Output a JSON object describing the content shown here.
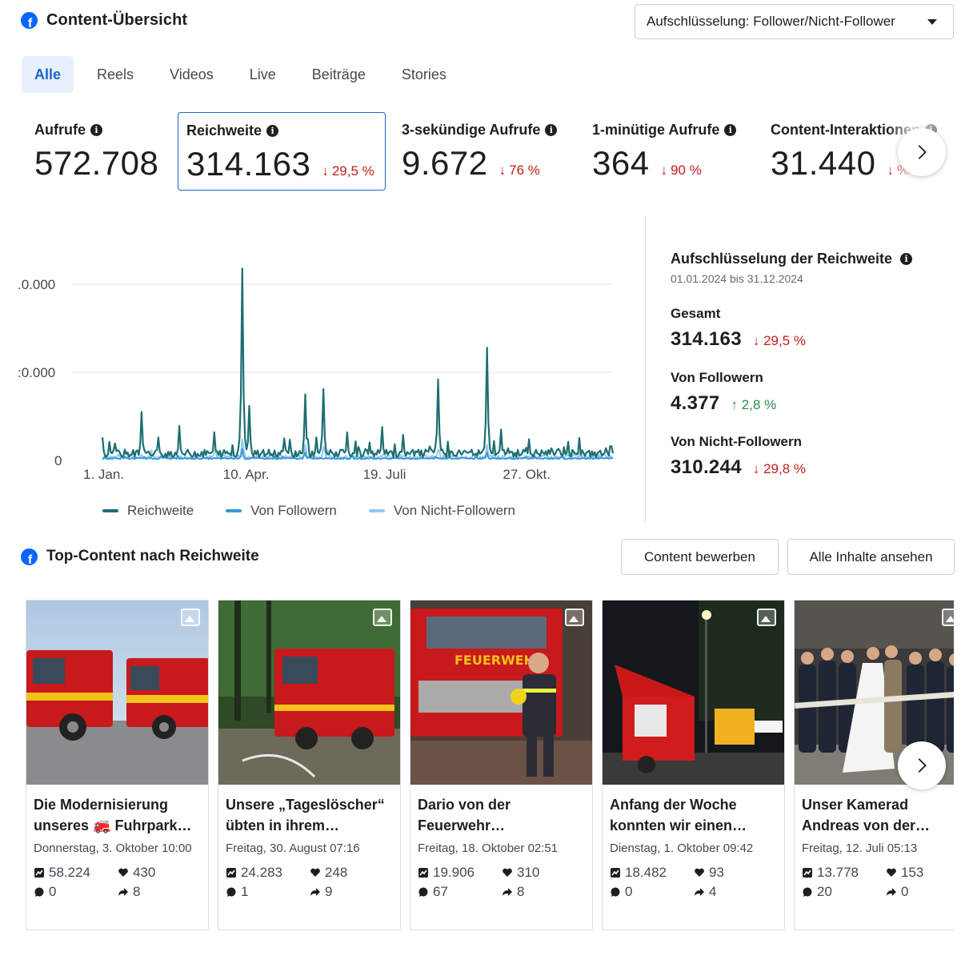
{
  "header": {
    "title": "Content-Übersicht",
    "breakdown_label": "Aufschlüsselung: Follower/Nicht-Follower"
  },
  "tabs": [
    {
      "label": "Alle",
      "active": true
    },
    {
      "label": "Reels"
    },
    {
      "label": "Videos"
    },
    {
      "label": "Live"
    },
    {
      "label": "Beiträge"
    },
    {
      "label": "Stories"
    }
  ],
  "metrics": [
    {
      "label": "Aufrufe",
      "value": "572.708",
      "delta": ""
    },
    {
      "label": "Reichweite",
      "value": "314.163",
      "delta": "29,5 %"
    },
    {
      "label": "3-sekündige Aufrufe",
      "value": "9.672",
      "delta": "76 %"
    },
    {
      "label": "1-minütige Aufrufe",
      "value": "364",
      "delta": "90 %"
    },
    {
      "label": "Content-Interaktionen",
      "value": "31.440",
      "delta": "%"
    }
  ],
  "chart_data": {
    "type": "line",
    "title": "",
    "xlabel": "",
    "ylabel": "",
    "x_ticks": [
      "1. Jan.",
      "10. Apr.",
      "19. Juli",
      "27. Okt."
    ],
    "y_ticks": [
      ".0.000",
      ":0.000",
      "0"
    ],
    "y_tick_values": [
      20000,
      10000,
      0
    ],
    "ylim": [
      0,
      20000
    ],
    "x_domain_days": [
      0,
      365
    ],
    "x_tick_days": [
      0,
      100,
      200,
      300
    ],
    "grid": true,
    "legend_position": "bottom",
    "series": [
      {
        "name": "Reichweite",
        "color": "#1d6f72",
        "peaks": [
          [
            5,
            2100
          ],
          [
            28,
            5500
          ],
          [
            55,
            3900
          ],
          [
            80,
            3200
          ],
          [
            100,
            21800
          ],
          [
            105,
            6200
          ],
          [
            130,
            2500
          ],
          [
            145,
            7500
          ],
          [
            158,
            8100
          ],
          [
            175,
            3200
          ],
          [
            200,
            3800
          ],
          [
            215,
            2900
          ],
          [
            240,
            9200
          ],
          [
            275,
            12800
          ],
          [
            285,
            3500
          ],
          [
            305,
            2400
          ],
          [
            330,
            1500
          ],
          [
            363,
            1600
          ]
        ],
        "baseline": 700
      },
      {
        "name": "Von Followern",
        "color": "#3b97d8",
        "peaks": [
          [
            100,
            1300
          ],
          [
            145,
            900
          ],
          [
            275,
            900
          ]
        ],
        "baseline": 200
      },
      {
        "name": "Von Nicht-Followern",
        "color": "#92c9f1",
        "peaks": [
          [
            100,
            2400
          ],
          [
            145,
            1800
          ],
          [
            158,
            1600
          ],
          [
            240,
            1200
          ],
          [
            275,
            1800
          ]
        ],
        "baseline": 350
      }
    ]
  },
  "reach": {
    "title": "Aufschlüsselung der Reichweite",
    "range": "01.01.2024 bis 31.12.2024",
    "items": [
      {
        "label": "Gesamt",
        "value": "314.163",
        "delta": "29,5 %",
        "direction": "down"
      },
      {
        "label": "Von Followern",
        "value": "4.377",
        "delta": "2,8 %",
        "direction": "up"
      },
      {
        "label": "Von Nicht-Followern",
        "value": "310.244",
        "delta": "29,8 %",
        "direction": "down"
      }
    ]
  },
  "top": {
    "title": "Top-Content nach Reichweite",
    "promote_label": "Content bewerben",
    "all_label": "Alle Inhalte ansehen"
  },
  "cards": [
    {
      "title": "Die Modernisierung unseres 🚒 Fuhrpark…",
      "date": "Donnerstag, 3. Oktober 10:00",
      "reach": "58.224",
      "likes": "430",
      "comments": "0",
      "shares": "8"
    },
    {
      "title": "Unsere „Tageslöscher“ übten in ihrem…",
      "date": "Freitag, 30. August 07:16",
      "reach": "24.283",
      "likes": "248",
      "comments": "1",
      "shares": "9"
    },
    {
      "title": "Dario von der Feuerwehr…",
      "date": "Freitag, 18. Oktober 02:51",
      "reach": "19.906",
      "likes": "310",
      "comments": "67",
      "shares": "8"
    },
    {
      "title": "Anfang der Woche konnten wir einen…",
      "date": "Dienstag, 1. Oktober 09:42",
      "reach": "18.482",
      "likes": "93",
      "comments": "0",
      "shares": "4"
    },
    {
      "title": "Unser Kamerad Andreas von der…",
      "date": "Freitag, 12. Juli 05:13",
      "reach": "13.778",
      "likes": "153",
      "comments": "20",
      "shares": "0"
    }
  ],
  "icons": {
    "logo": "facebook-icon",
    "info": "info-icon",
    "next": "chevron-right-icon",
    "reach": "reach-icon",
    "like": "heart-icon",
    "comment": "comment-icon",
    "share": "share-icon"
  }
}
